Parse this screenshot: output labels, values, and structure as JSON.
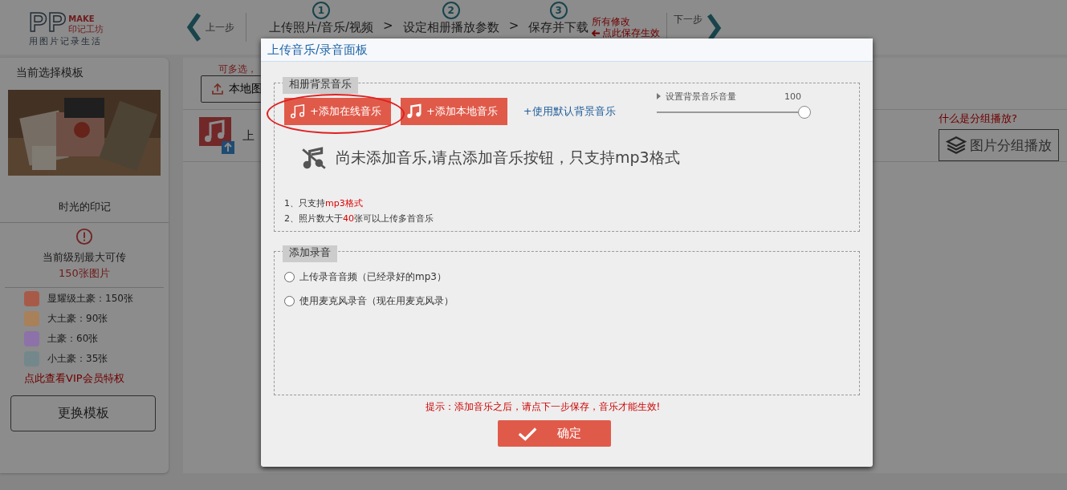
{
  "logo": {
    "mark": "PP",
    "make": "MAKE",
    "brand": "印记工坊",
    "slogan": "用图片记录生活"
  },
  "nav": {
    "prev": "上一步",
    "next": "下一步",
    "save_note": [
      "所有修改",
      "点此保存生效"
    ],
    "steps": [
      {
        "number": "1",
        "label": "上传照片/音乐/视频"
      },
      {
        "number": "2",
        "label": "设定相册播放参数"
      },
      {
        "number": "3",
        "label": "保存并下载"
      }
    ],
    "separator": ">"
  },
  "sidebar": {
    "title": "当前选择模板",
    "template_name": "时光的印记",
    "limit_label": "当前级别最大可传",
    "limit_value": "150张图片",
    "levels": [
      {
        "label": "显耀级土豪：150张",
        "color": "#a85a48"
      },
      {
        "label": "大土豪：90张",
        "color": "#a8805a"
      },
      {
        "label": "土豪：60张",
        "color": "#8c72a8"
      },
      {
        "label": "小土豪：35张",
        "color": "#74888c"
      }
    ],
    "vip_link": "点此查看VIP会员特权",
    "change_button": "更换模板"
  },
  "main": {
    "hint": "可多选，",
    "upload_button": "本地图",
    "music_row": "上",
    "group_question": "什么是分组播放?",
    "group_button": "图片分组播放"
  },
  "dialog": {
    "title": "上传音乐/录音面板",
    "music_section": {
      "legend": "相册背景音乐",
      "online_button": "+添加在线音乐",
      "local_button": "+添加本地音乐",
      "default_link": "+使用默认背景音乐",
      "volume": {
        "label": "设置背景音乐音量",
        "reading": "100",
        "level": 1.0
      },
      "empty_message": "尚未添加音乐,请点添加音乐按钮，只支持mp3格式",
      "notes": [
        "1、只支持**mp3格式**",
        "2、照片数大于**40**张可以上传多首音乐"
      ]
    },
    "record_section": {
      "legend": "添加录音",
      "options": [
        {
          "label": "上传录音音频（已经录好的mp3）",
          "selected": false
        },
        {
          "label": "使用麦克风录音（现在用麦克风录）",
          "selected": false
        }
      ]
    },
    "tip": "提示：添加音乐之后，请点下一步保存，音乐才能生效!",
    "confirm": "确定"
  }
}
